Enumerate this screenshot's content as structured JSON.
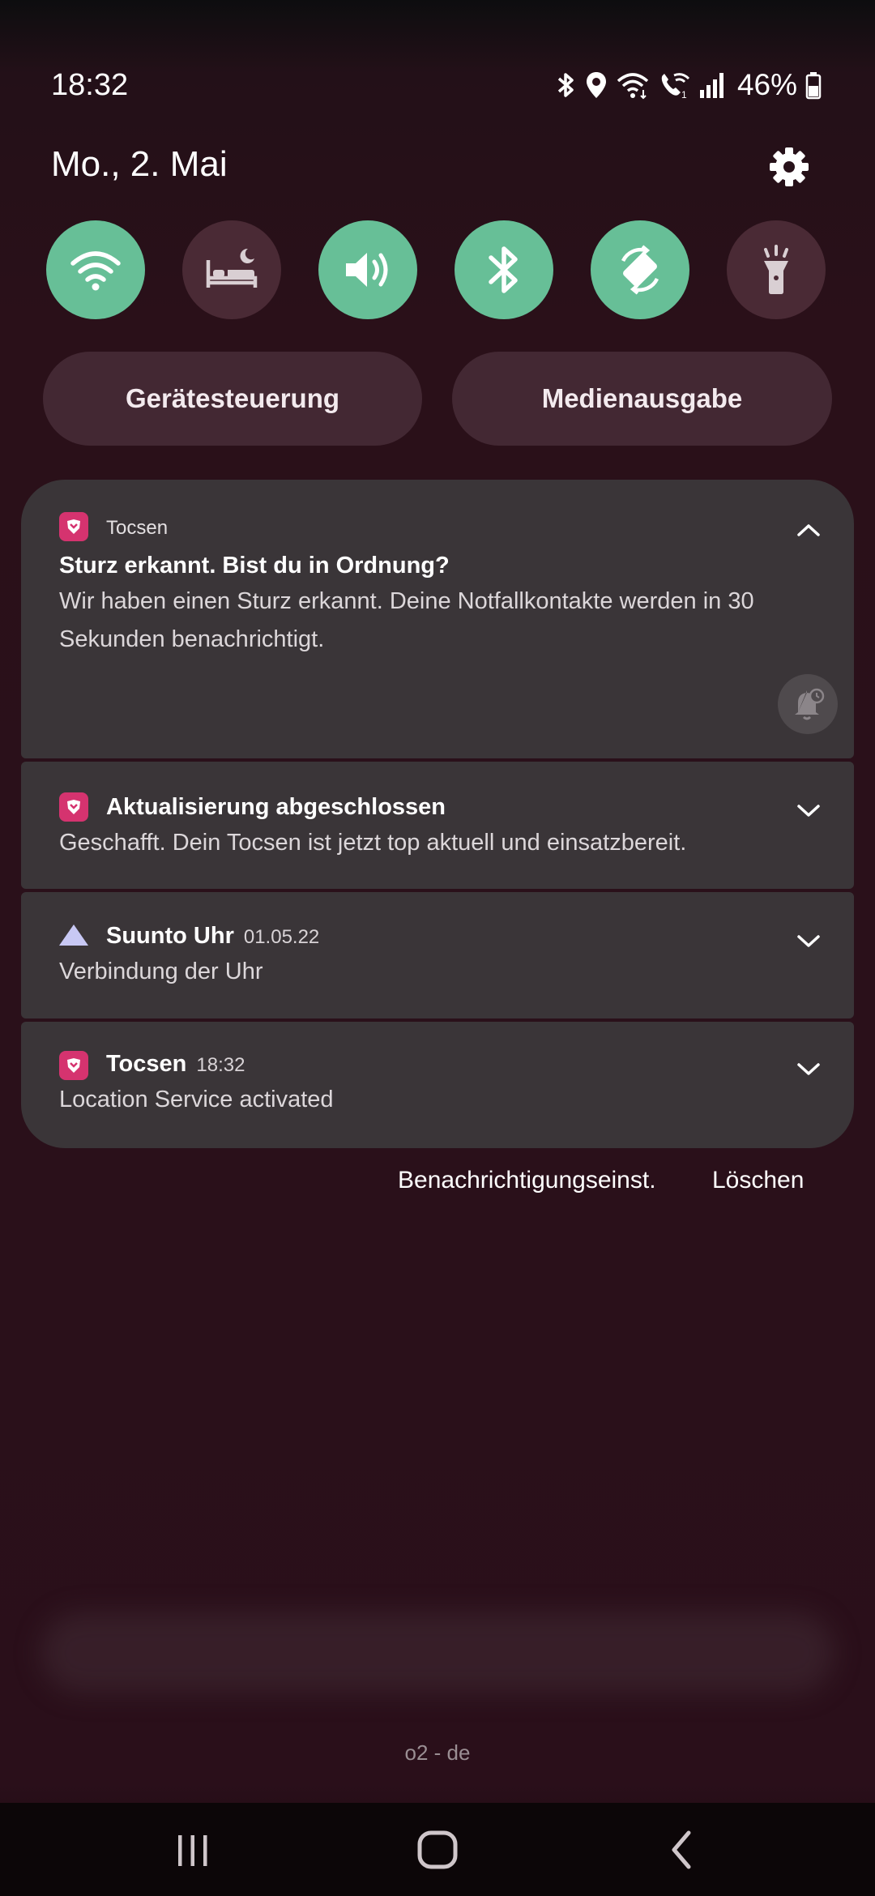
{
  "status_bar": {
    "time": "18:32",
    "battery": "46%",
    "icons": [
      "bluetooth-icon",
      "location-icon",
      "wifi-icon",
      "wifi-calling-icon",
      "signal-icon",
      "battery-icon"
    ]
  },
  "header": {
    "date": "Mo., 2. Mai",
    "settings_icon": "gear-icon"
  },
  "quick_settings": [
    {
      "icon": "wifi-icon",
      "on": true
    },
    {
      "icon": "sleep-mode-icon",
      "on": false
    },
    {
      "icon": "sound-icon",
      "on": true
    },
    {
      "icon": "bluetooth-icon",
      "on": true
    },
    {
      "icon": "auto-rotate-icon",
      "on": true
    },
    {
      "icon": "flashlight-icon",
      "on": false
    }
  ],
  "pills": {
    "device_control": "Gerätesteuerung",
    "media_output": "Medienausgabe"
  },
  "notifications": [
    {
      "app": "Tocsen",
      "title": "Sturz erkannt. Bist du in Ordnung?",
      "body": "Wir haben einen Sturz erkannt. Deine Notfallkontakte werden in 30 Sekunden benachrichtigt.",
      "expanded": true
    },
    {
      "app": "Aktualisierung abgeschlossen",
      "body": "Geschafft. Dein Tocsen ist jetzt top aktuell und einsatzbereit."
    },
    {
      "app": "Suunto Uhr",
      "time": "01.05.22",
      "body": "Verbindung der Uhr"
    },
    {
      "app": "Tocsen",
      "time": "18:32",
      "body": "Location Service activated"
    }
  ],
  "actions": {
    "settings": "Benachrichtigungseinst.",
    "clear": "Löschen"
  },
  "carrier": "o2 - de",
  "colors": {
    "qs_on": "#67bf97",
    "qs_off": "#4a2a35",
    "tocsen_brand": "#d5336f",
    "suunto_brand": "#c8c8f4",
    "card_bg": "#3a3538"
  }
}
